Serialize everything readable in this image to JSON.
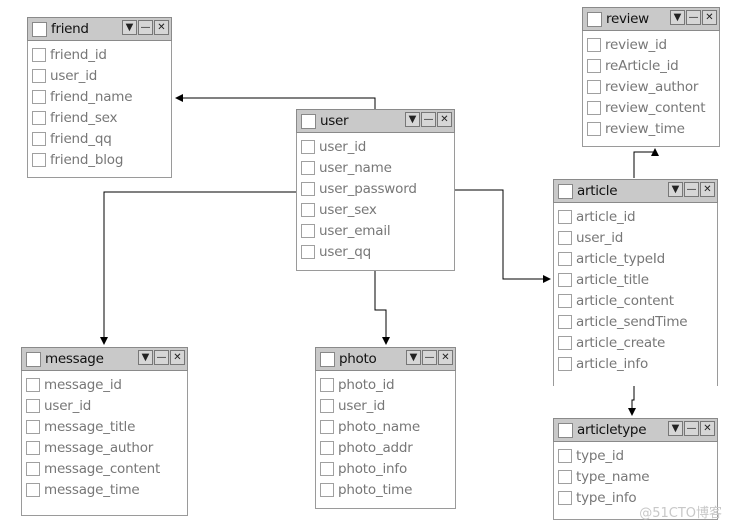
{
  "tables": {
    "friend": {
      "name": "friend",
      "fields": [
        "friend_id",
        "user_id",
        "friend_name",
        "friend_sex",
        "friend_qq",
        "friend_blog"
      ]
    },
    "user": {
      "name": "user",
      "fields": [
        "user_id",
        "user_name",
        "user_password",
        "user_sex",
        "user_email",
        "user_qq"
      ]
    },
    "review": {
      "name": "review",
      "fields": [
        "review_id",
        "reArticle_id",
        "review_author",
        "review_content",
        "review_time"
      ]
    },
    "article": {
      "name": "article",
      "fields": [
        "article_id",
        "user_id",
        "article_typeId",
        "article_title",
        "article_content",
        "article_sendTime",
        "article_create",
        "article_info"
      ]
    },
    "message": {
      "name": "message",
      "fields": [
        "message_id",
        "user_id",
        "message_title",
        "message_author",
        "message_content",
        "message_time"
      ]
    },
    "photo": {
      "name": "photo",
      "fields": [
        "photo_id",
        "user_id",
        "photo_name",
        "photo_addr",
        "photo_info",
        "photo_time"
      ]
    },
    "articletype": {
      "name": "articletype",
      "fields": [
        "type_id",
        "type_name",
        "type_info"
      ]
    }
  },
  "watermark": "@51CTO博客"
}
